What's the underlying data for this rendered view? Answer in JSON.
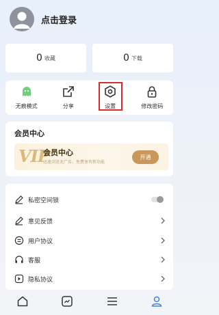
{
  "profile": {
    "login_label": "点击登录"
  },
  "stats": [
    {
      "count": "0",
      "label": "收藏"
    },
    {
      "count": "0",
      "label": "下载"
    }
  ],
  "tools": [
    {
      "label": "无痕模式",
      "icon": "ghost-icon"
    },
    {
      "label": "分享",
      "icon": "share-icon"
    },
    {
      "label": "设置",
      "icon": "settings-icon"
    },
    {
      "label": "修改密码",
      "icon": "lock-icon"
    }
  ],
  "vip": {
    "section_title": "会员中心",
    "logo": "VIP",
    "name": "会员中心",
    "description": "迅速浏览无广告，免费享有新功能",
    "button_label": "开通"
  },
  "menu": [
    {
      "label": "私密空间锁",
      "icon": "pen-icon",
      "control": "toggle",
      "toggle_on": false
    },
    {
      "label": "意见反馈",
      "icon": "feedback-icon",
      "control": "arrow"
    },
    {
      "label": "用户协议",
      "icon": "agreement-icon",
      "control": "arrow"
    },
    {
      "label": "客服",
      "icon": "headset-icon",
      "control": "arrow"
    },
    {
      "label": "隐私协议",
      "icon": "privacy-icon",
      "control": "arrow"
    }
  ],
  "tabbar": [
    {
      "icon": "home-icon",
      "active": false
    },
    {
      "icon": "video-icon",
      "active": false
    },
    {
      "icon": "list-icon",
      "active": false
    },
    {
      "icon": "profile-icon",
      "active": true
    }
  ],
  "colors": {
    "accent": "#3d86d8",
    "vip_gold": "#c9975a",
    "highlight_red": "#d62b2b"
  }
}
